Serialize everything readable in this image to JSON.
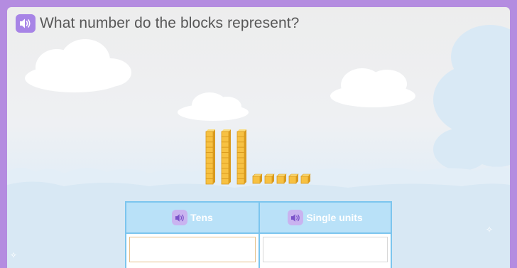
{
  "question": {
    "text": "What number do the blocks represent?",
    "audio_icon": "speaker-icon"
  },
  "blocks": {
    "tens": 3,
    "ones": 5,
    "color": "#f7c142"
  },
  "answer_table": {
    "columns": [
      {
        "label": "Tens",
        "audio_icon": "speaker-icon",
        "value": ""
      },
      {
        "label": "Single units",
        "audio_icon": "speaker-icon",
        "value": ""
      }
    ]
  },
  "colors": {
    "frame": "#b48ce0",
    "speaker_button": "#a784e6",
    "table_border": "#7cc5ee",
    "table_header": "#b9e1f8",
    "active_input_border": "#e7c18b"
  }
}
